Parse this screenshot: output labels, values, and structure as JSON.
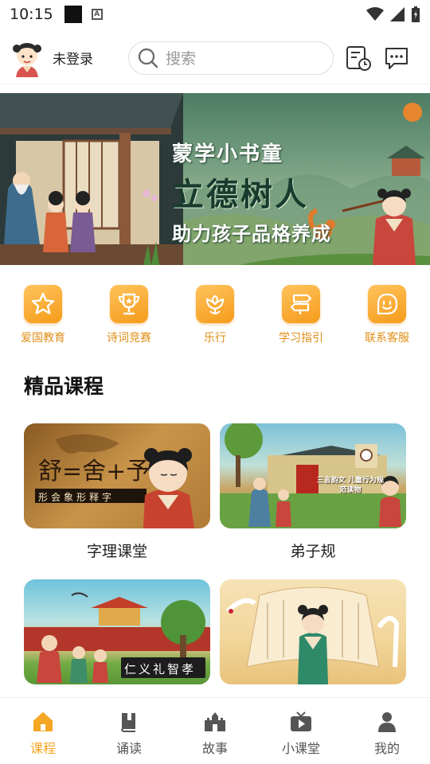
{
  "status": {
    "time": "10:15"
  },
  "header": {
    "login_text": "未登录",
    "search_placeholder": "搜索"
  },
  "banner": {
    "line1": "蒙学小书童",
    "line2": "立德树人",
    "line3": "助力孩子品格养成"
  },
  "menu": [
    {
      "label": "爱国教育",
      "icon": "star-icon"
    },
    {
      "label": "诗词竞赛",
      "icon": "trophy-icon"
    },
    {
      "label": "乐行",
      "icon": "flower-icon"
    },
    {
      "label": "学习指引",
      "icon": "signpost-icon"
    },
    {
      "label": "联系客服",
      "icon": "chat-face-icon"
    }
  ],
  "section": {
    "title": "精品课程"
  },
  "courses": [
    {
      "label": "字理课堂",
      "image_text": "形会象形释字"
    },
    {
      "label": "弟子规",
      "image_text": "三言韵文 儿童行为规范读物"
    },
    {
      "image_text": "仁义礼智孝"
    },
    {
      "image_text": ""
    }
  ],
  "bottom_nav": [
    {
      "label": "课程",
      "icon": "home-icon",
      "active": true
    },
    {
      "label": "诵读",
      "icon": "book-icon",
      "active": false
    },
    {
      "label": "故事",
      "icon": "castle-icon",
      "active": false
    },
    {
      "label": "小课堂",
      "icon": "tv-icon",
      "active": false
    },
    {
      "label": "我的",
      "icon": "person-icon",
      "active": false
    }
  ],
  "colors": {
    "accent": "#f5a623",
    "menu_label": "#e08f16"
  }
}
